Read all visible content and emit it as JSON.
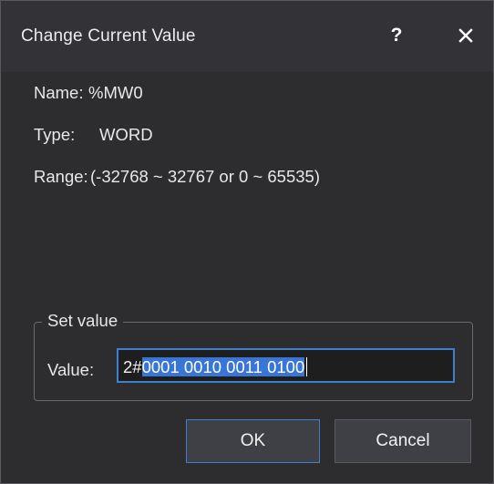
{
  "dialog": {
    "title": "Change Current Value",
    "help_glyph": "?",
    "close_icon": "close-icon"
  },
  "info": {
    "name_label": "Name:",
    "name_value": "%MW0",
    "type_label": "Type:",
    "type_value": "WORD",
    "range_label": "Range:",
    "range_value": "(-32768 ~ 32767 or 0 ~ 65535)"
  },
  "set_value": {
    "group_label": "Set value",
    "value_label": "Value:",
    "value_prefix": "2#",
    "value_selected": "0001 0010 0011 0100"
  },
  "buttons": {
    "ok": "OK",
    "cancel": "Cancel"
  },
  "colors": {
    "background": "#2d2d30",
    "accent": "#3e7fce",
    "selection": "#3875d7"
  }
}
